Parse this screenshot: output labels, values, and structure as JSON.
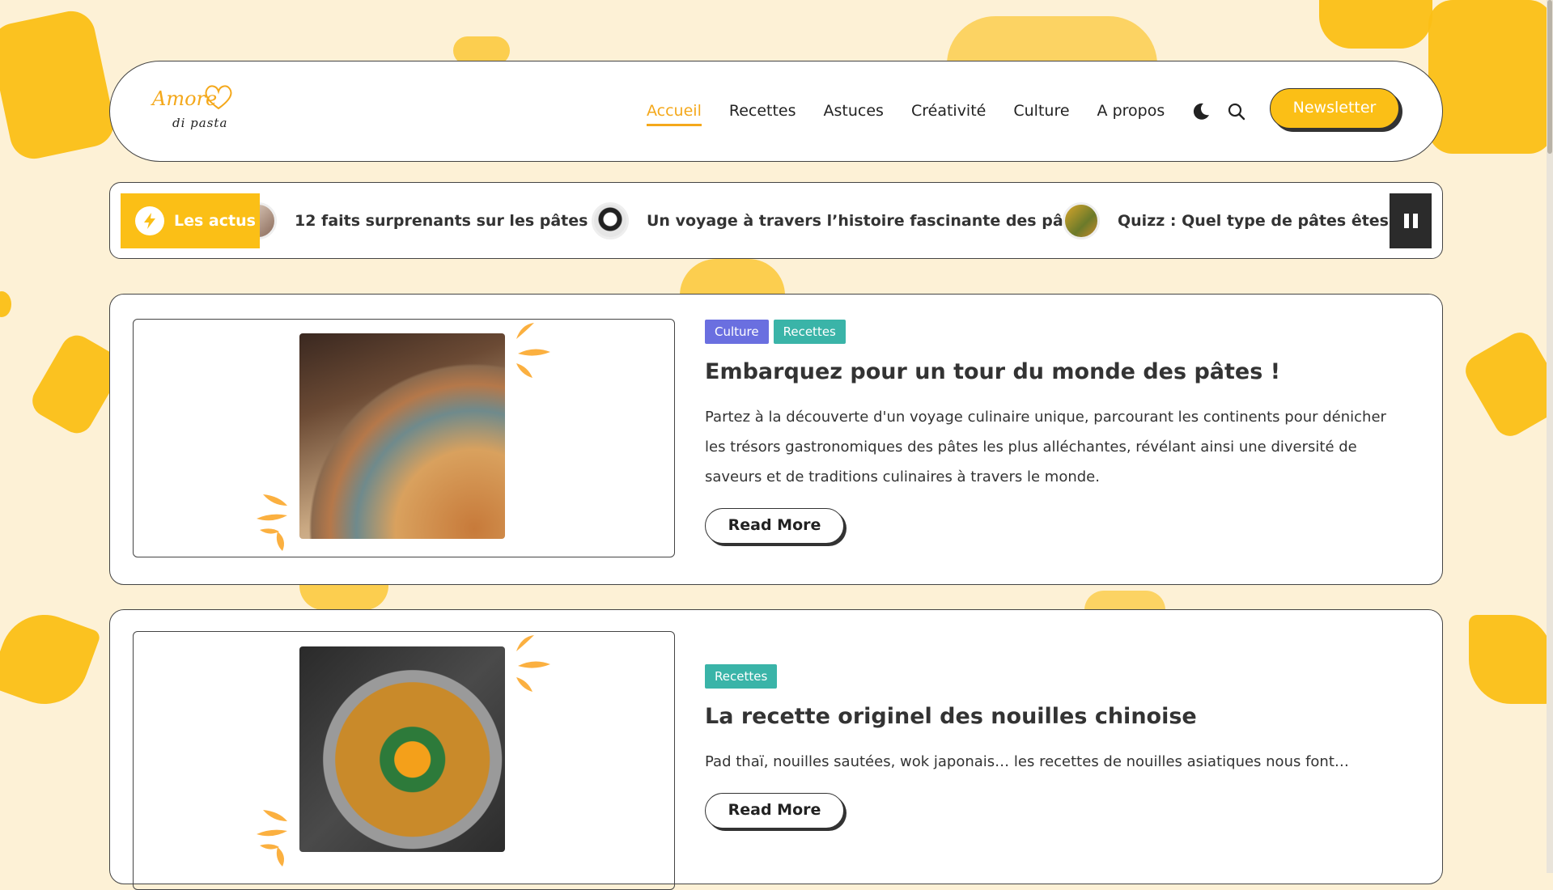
{
  "brand": {
    "logo_text_top": "Amore",
    "logo_text_bottom": "di pasta"
  },
  "nav": {
    "items": [
      {
        "label": "Accueil",
        "active": true
      },
      {
        "label": "Recettes",
        "active": false
      },
      {
        "label": "Astuces",
        "active": false
      },
      {
        "label": "Créativité",
        "active": false
      },
      {
        "label": "Culture",
        "active": false
      },
      {
        "label": "A propos",
        "active": false
      }
    ],
    "newsletter_label": "Newsletter"
  },
  "ticker": {
    "label": "Les actus",
    "items": [
      {
        "text": "12 faits surprenants sur les pâtes !"
      },
      {
        "text": "Un voyage à travers l’histoire fascinante des pâtes"
      },
      {
        "text": "Quizz : Quel type de pâtes êtes vous"
      }
    ]
  },
  "articles": [
    {
      "tags": [
        "Culture",
        "Recettes"
      ],
      "title": "Embarquez pour un tour du monde des pâtes !",
      "excerpt": "Partez à la découverte d'un voyage culinaire unique, parcourant les continents pour dénicher les trésors gastronomiques des pâtes les plus alléchantes, révélant ainsi une diversité de saveurs et de traditions culinaires à travers le monde.",
      "read_more": "Read More"
    },
    {
      "tags": [
        "Recettes"
      ],
      "title": "La recette originel des nouilles chinoise",
      "excerpt": "Pad thaï, nouilles sautées, wok japonais… les recettes de nouilles asiatiques nous font…",
      "read_more": "Read More"
    }
  ],
  "colors": {
    "accent": "#fbbf16",
    "background": "#fdf1d6",
    "tag_culture": "#6a6fe0",
    "tag_recettes": "#3ab4a8"
  }
}
